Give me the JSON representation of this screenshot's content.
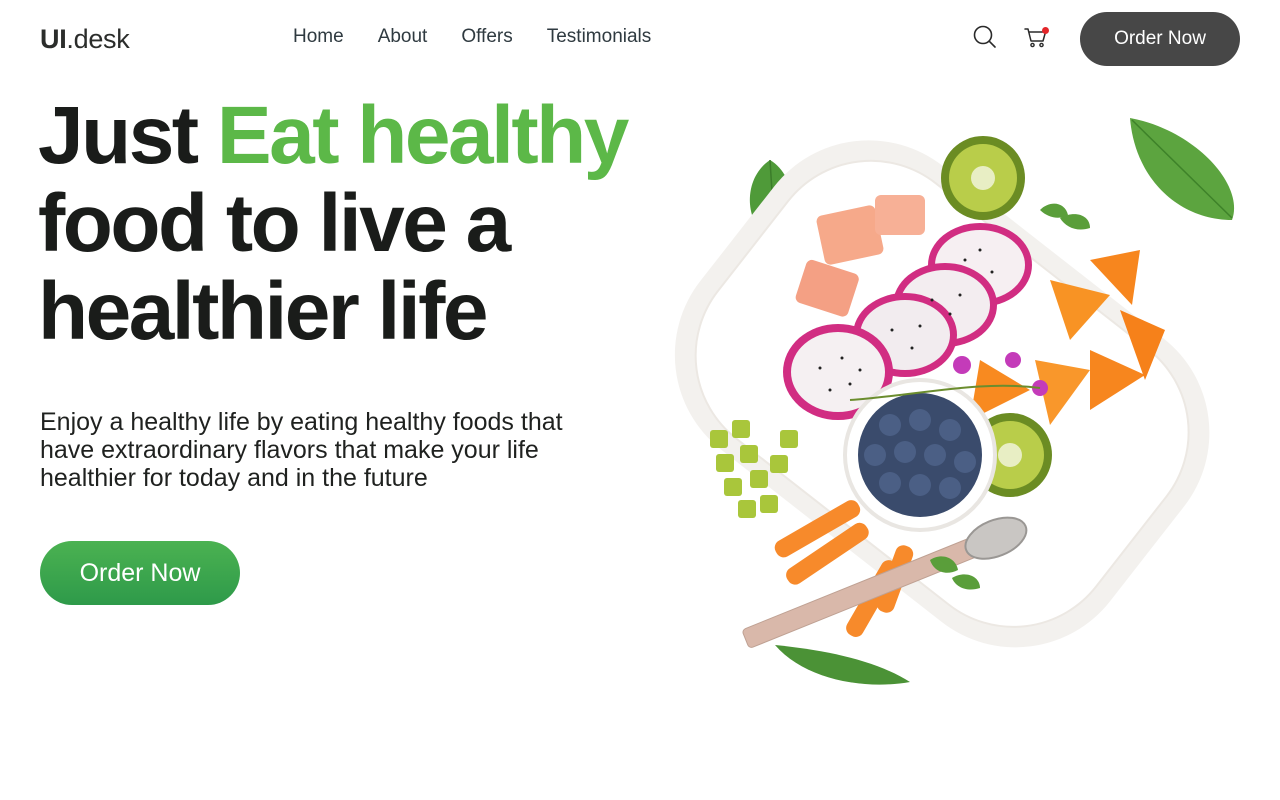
{
  "brand": {
    "name_main": "UI",
    "name_rest": ".desk"
  },
  "nav": {
    "items": [
      {
        "label": "Home"
      },
      {
        "label": "About"
      },
      {
        "label": "Offers"
      },
      {
        "label": "Testimonials"
      }
    ]
  },
  "header": {
    "icons": [
      "search-icon",
      "cart-icon"
    ],
    "cart_has_items": true,
    "order_label": "Order Now"
  },
  "hero": {
    "headline_part1": "Just ",
    "headline_accent": "Eat healthy",
    "headline_part2": "food to live a healthier life",
    "description": "Enjoy a healthy life by eating healthy foods that have extraordinary flavors that make your life healthier for today and in the future",
    "cta_label": "Order Now",
    "image_alt": "fruit-platter"
  },
  "colors": {
    "accent": "#5cb848",
    "cta_gradient_top": "#4bb251",
    "cta_gradient_bottom": "#2e9a4a",
    "header_button": "#474747",
    "cart_badge": "#e3262a"
  }
}
